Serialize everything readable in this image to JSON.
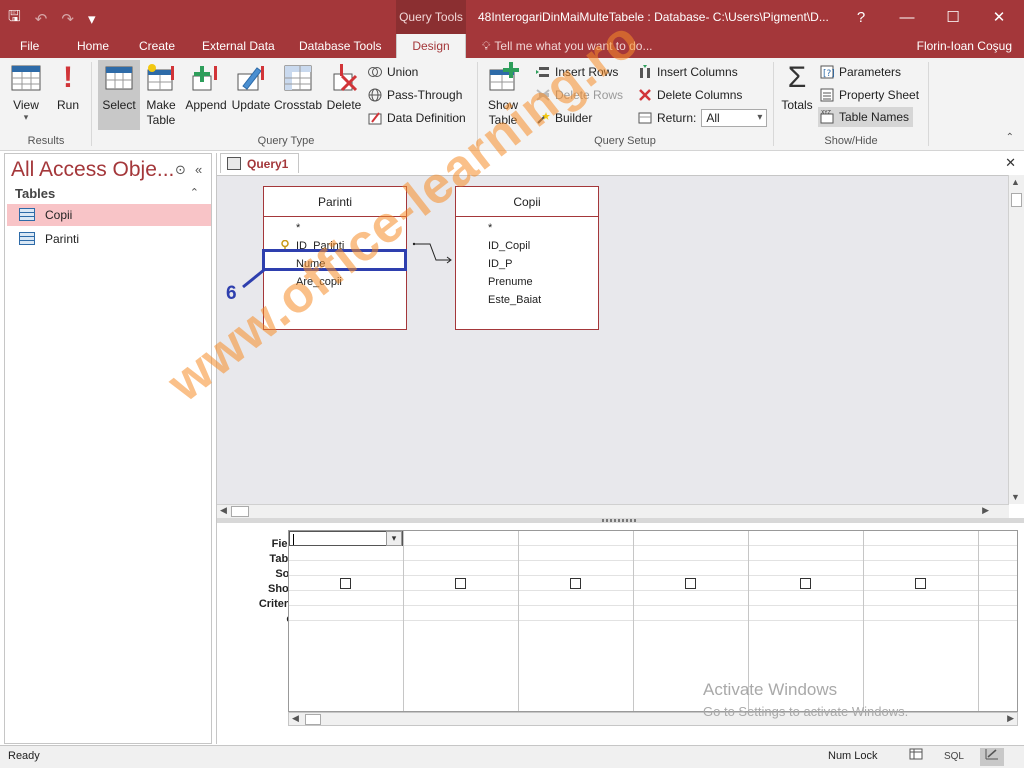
{
  "window": {
    "title": "48InterogariDinMaiMulteTabele : Database- C:\\Users\\Pigment\\D...",
    "context_tab": "Query Tools",
    "help": "?",
    "minimize": "—",
    "maximize": "☐",
    "close": "✕"
  },
  "qat": {
    "save": "🖫",
    "undo": "↶",
    "redo": "↷",
    "customize": "▾"
  },
  "tabs": [
    "File",
    "Home",
    "Create",
    "External Data",
    "Database Tools",
    "Design"
  ],
  "tellme": "Tell me what you want to do...",
  "user": "Florin-Ioan Coşug",
  "ribbon": {
    "results": {
      "label": "Results",
      "view": "View",
      "view_arrow": "▾",
      "run": "Run"
    },
    "query_type": {
      "label": "Query Type",
      "select": "Select",
      "make_table": "Make Table",
      "append": "Append",
      "update": "Update",
      "crosstab": "Crosstab",
      "delete": "Delete",
      "union": "Union",
      "pass_through": "Pass-Through",
      "data_definition": "Data Definition"
    },
    "query_setup": {
      "label": "Query Setup",
      "show_table": "Show Table",
      "insert_rows": "Insert Rows",
      "delete_rows": "Delete Rows",
      "builder": "Builder",
      "insert_columns": "Insert Columns",
      "delete_columns": "Delete Columns",
      "return_label": "Return:",
      "return_value": "All"
    },
    "show_hide": {
      "label": "Show/Hide",
      "totals": "Totals",
      "parameters": "Parameters",
      "property_sheet": "Property Sheet",
      "table_names": "Table Names"
    }
  },
  "nav": {
    "title": "All Access Obje...",
    "section": "Tables",
    "items": [
      "Copii",
      "Parinti"
    ]
  },
  "document": {
    "tab": "Query1",
    "close": "✕"
  },
  "tables": {
    "parinti": {
      "title": "Parinti",
      "fields": [
        "*",
        "ID_Parinti",
        "Nume",
        "Are_copii"
      ]
    },
    "copii": {
      "title": "Copii",
      "fields": [
        "*",
        "ID_Copil",
        "ID_P",
        "Prenume",
        "Este_Baiat"
      ]
    }
  },
  "callout": "6",
  "grid": {
    "row_labels": [
      "Field:",
      "Table:",
      "Sort:",
      "Show:",
      "Criteria:",
      "or:"
    ]
  },
  "activate": {
    "line1": "Activate Windows",
    "line2": "Go to Settings to activate Windows."
  },
  "watermark": "www.office-learning.ro",
  "status": {
    "left": "Ready",
    "num_lock": "Num Lock",
    "sql": "SQL"
  },
  "colors": {
    "accent": "#a4373a",
    "callout": "#2e3fae",
    "watermark": "#f58c28"
  }
}
